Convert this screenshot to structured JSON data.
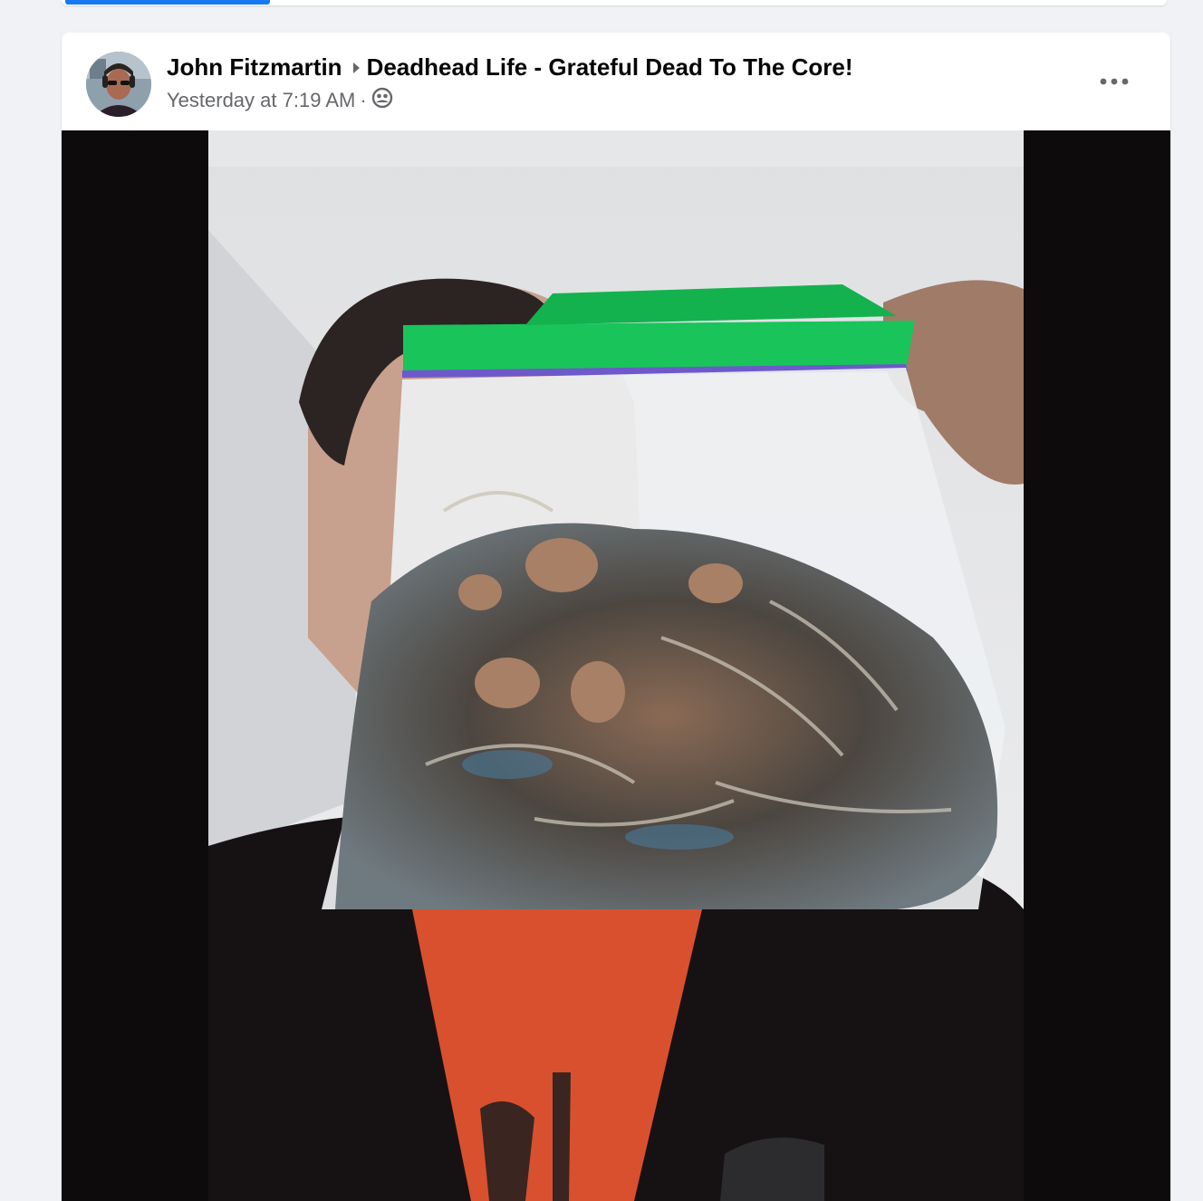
{
  "post": {
    "author": "John Fitzmartin",
    "group": "Deadhead Life - Grateful Dead To The Core!",
    "timestamp": "Yesterday at 7:19 AM",
    "separator": "·",
    "privacy_icon": "friends-audience-icon",
    "more_icon": "more-options-icon",
    "avatar_icon": "profile-photo",
    "photo": "post-photo-person-holding-bag"
  },
  "colors": {
    "accent": "#1877f2",
    "page_background": "#f0f2f5",
    "card_background": "#ffffff",
    "primary_text": "#050505",
    "secondary_text": "#65676b",
    "photo_letterbox": "#0d0b0c"
  }
}
